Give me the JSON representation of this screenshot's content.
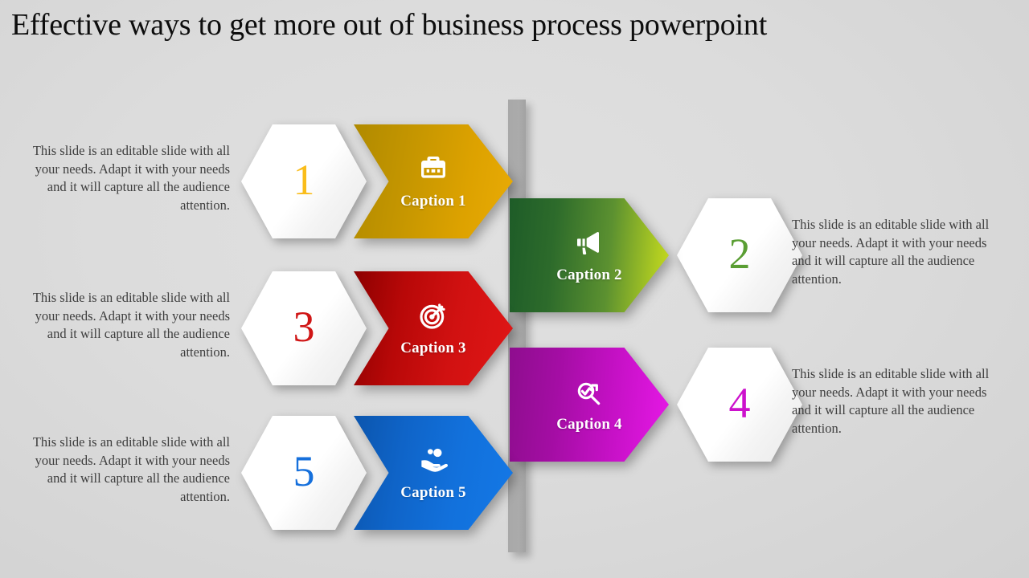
{
  "slide": {
    "title": "Effective ways to get more out of business process powerpoint",
    "background_color": "#dcdcdc",
    "center_bar_color": "#a8a8a8"
  },
  "body_text": "This slide is an editable slide with all your needs. Adapt it with your needs and it will capture all the audience attention.",
  "steps": [
    {
      "number": "1",
      "number_color": "#FABD1B",
      "caption": "Caption 1",
      "icon": "briefcase-icon",
      "color_start": "#b08a00",
      "color_end": "#e0a400",
      "side": "left",
      "direction": "right-notched"
    },
    {
      "number": "2",
      "number_color": "#5A9E33",
      "caption": "Caption 2",
      "icon": "megaphone-icon",
      "color_start": "#1e5c28",
      "color_end": "#c3d61f",
      "side": "right",
      "direction": "right-flat"
    },
    {
      "number": "3",
      "number_color": "#D01616",
      "caption": "Caption 3",
      "icon": "target-icon",
      "color_start": "#8c0000",
      "color_end": "#e01414",
      "side": "left",
      "direction": "right-notched"
    },
    {
      "number": "4",
      "number_color": "#CC11CC",
      "caption": "Caption 4",
      "icon": "search-chart-icon",
      "color_start": "#8e0d8e",
      "color_end": "#e618e6",
      "side": "right",
      "direction": "right-flat"
    },
    {
      "number": "5",
      "number_color": "#1670DC",
      "caption": "Caption 5",
      "icon": "hand-people-icon",
      "color_start": "#0b55ad",
      "color_end": "#1478e6",
      "side": "left",
      "direction": "right-notched"
    }
  ]
}
